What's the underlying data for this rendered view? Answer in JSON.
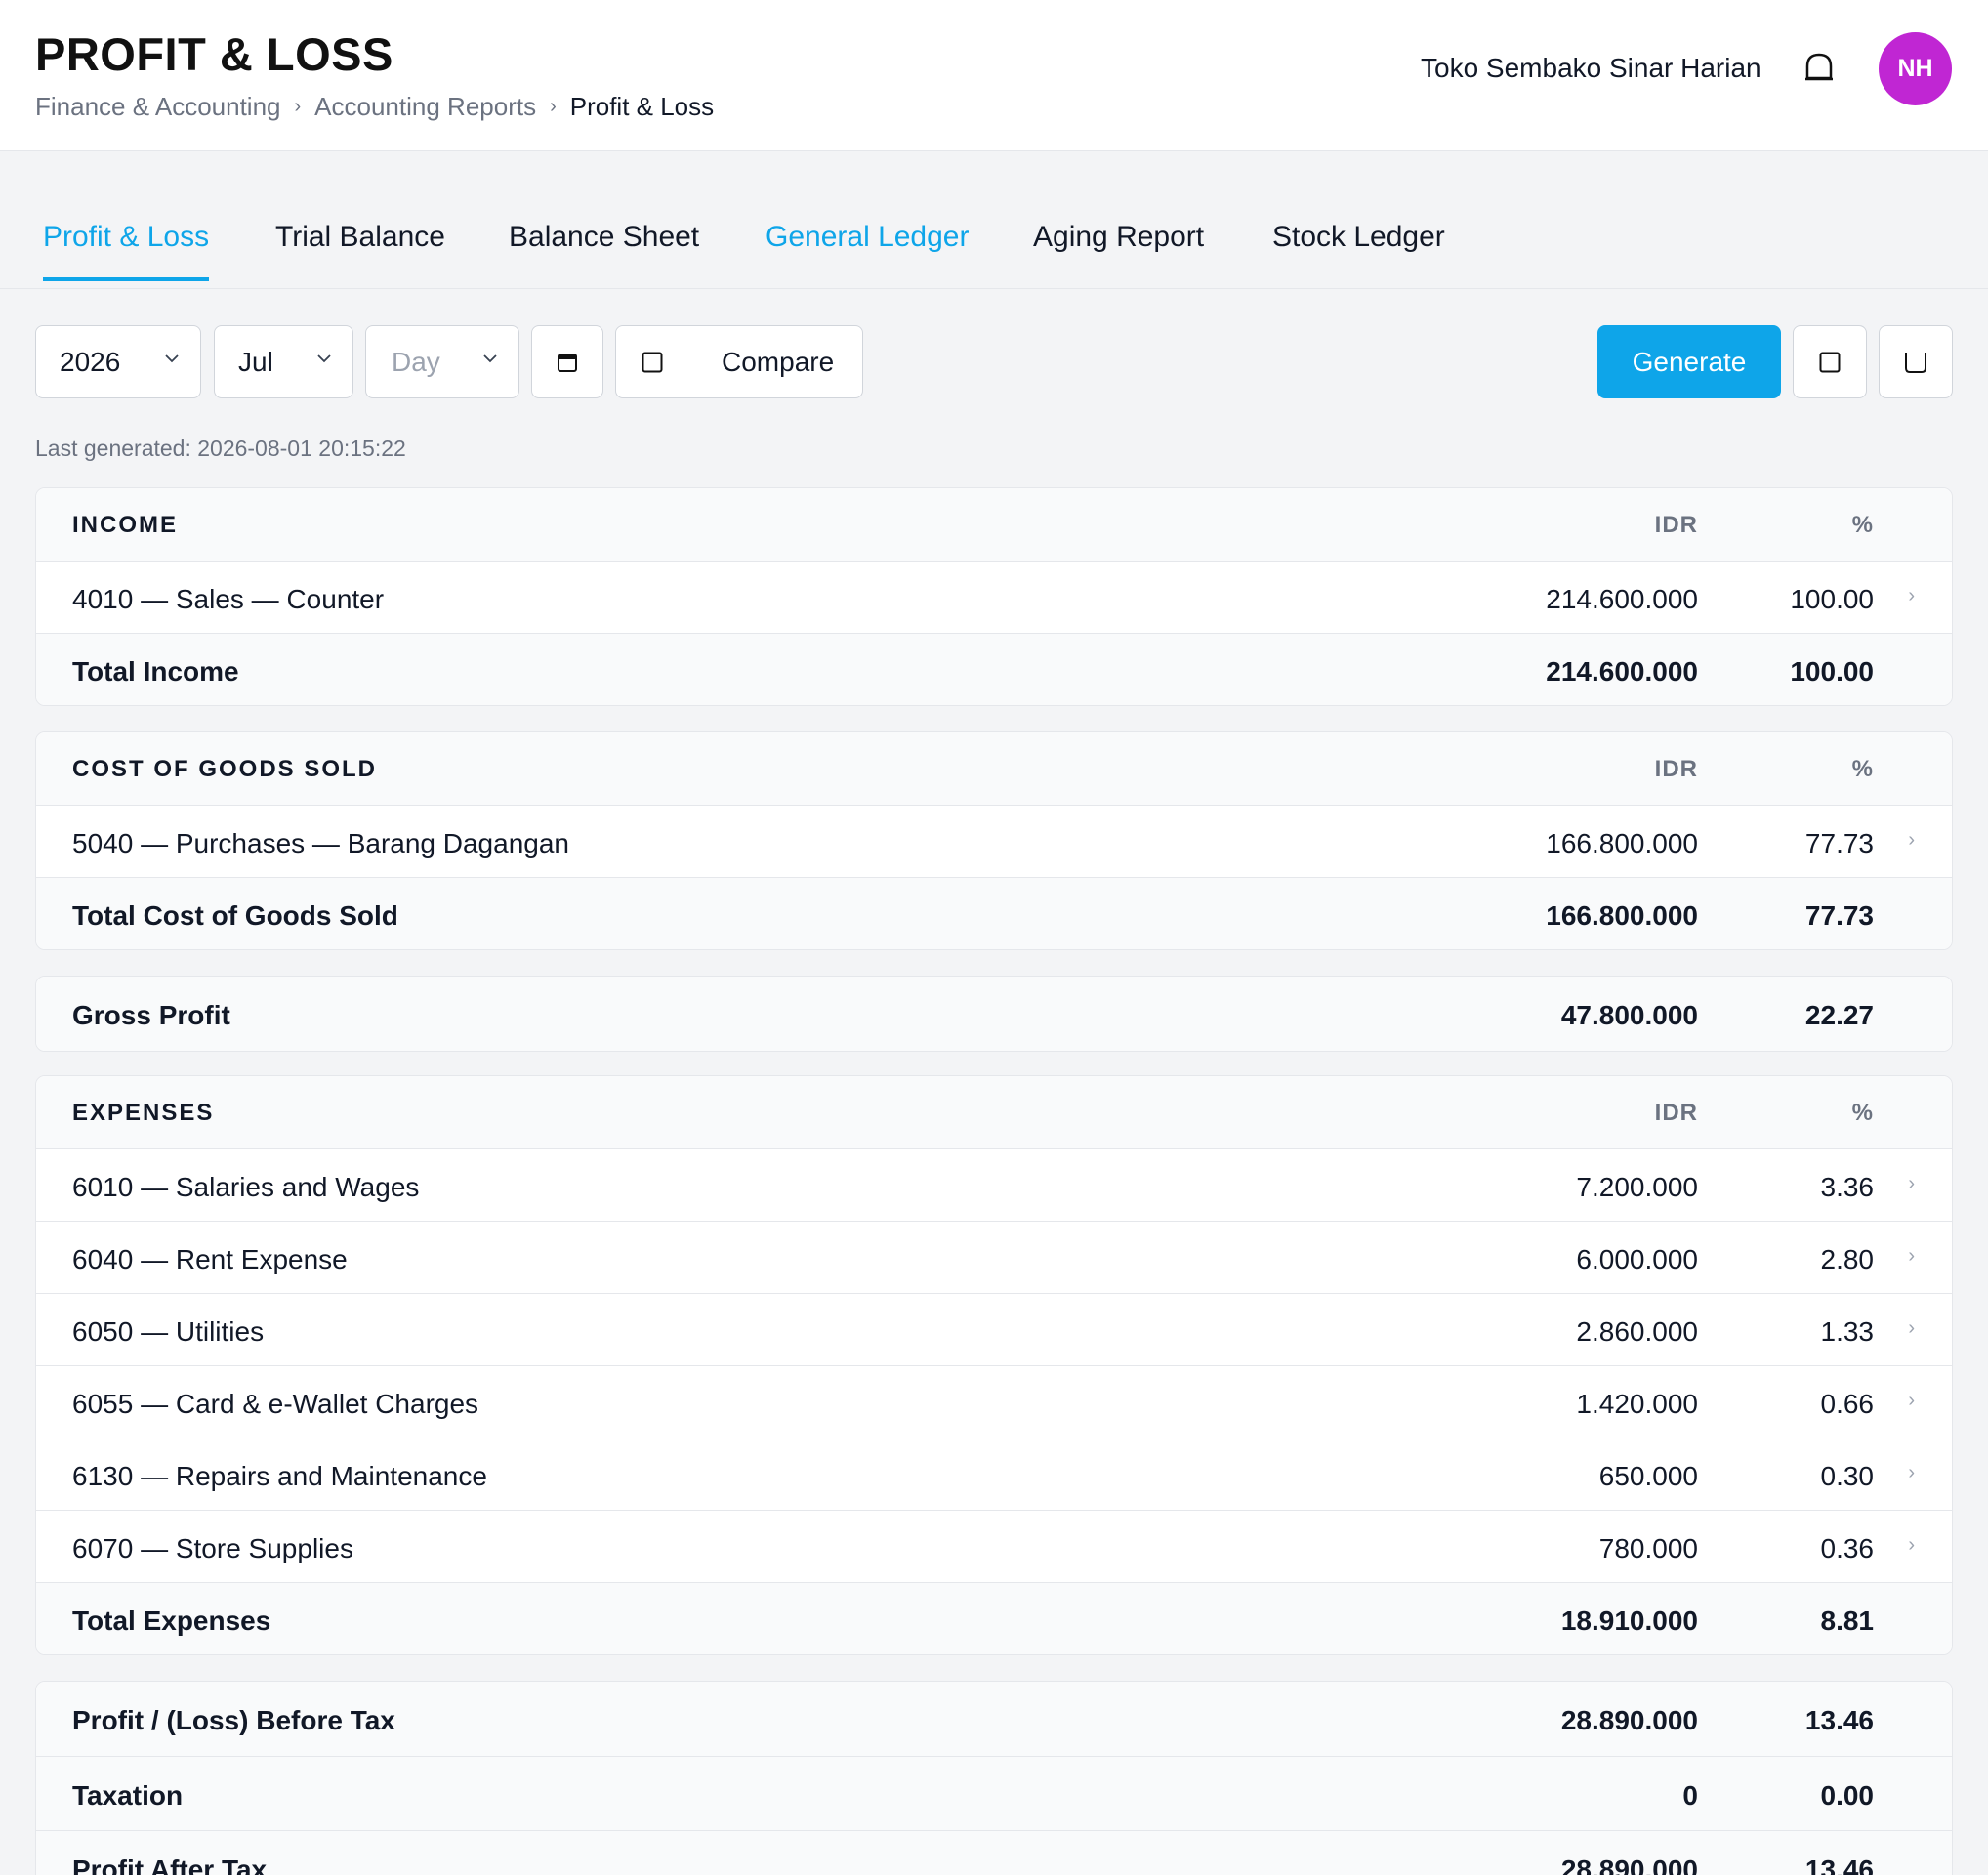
{
  "header": {
    "title": "PROFIT & LOSS",
    "breadcrumb": [
      "Finance & Accounting",
      "Accounting Reports",
      "Profit & Loss"
    ],
    "store_name": "Toko Sembako Sinar Harian",
    "avatar_initials": "NH"
  },
  "tabs": [
    {
      "label": "Profit & Loss",
      "state": "active"
    },
    {
      "label": "Trial Balance",
      "state": "normal"
    },
    {
      "label": "Balance Sheet",
      "state": "normal"
    },
    {
      "label": "General Ledger",
      "state": "link"
    },
    {
      "label": "Aging Report",
      "state": "normal"
    },
    {
      "label": "Stock Ledger",
      "state": "normal"
    }
  ],
  "toolbar": {
    "year": "2026",
    "month": "Jul",
    "day_placeholder": "Day",
    "compare_label": "Compare",
    "generate_label": "Generate"
  },
  "last_generated": "Last generated: 2026-08-01 20:15:22",
  "income": {
    "header": "INCOME",
    "col_amount": "IDR",
    "col_pct": "%",
    "rows": [
      {
        "label": "4010 — Sales — Counter",
        "amount": "214.600.000",
        "pct": "100.00"
      }
    ],
    "total": {
      "label": "Total Income",
      "amount": "214.600.000",
      "pct": "100.00"
    }
  },
  "cogs": {
    "header": "COST OF GOODS SOLD",
    "col_amount": "IDR",
    "col_pct": "%",
    "rows": [
      {
        "label": "5040 — Purchases — Barang Dagangan",
        "amount": "166.800.000",
        "pct": "77.73"
      }
    ],
    "total": {
      "label": "Total Cost of Goods Sold",
      "amount": "166.800.000",
      "pct": "77.73"
    }
  },
  "gross_profit": {
    "label": "Gross Profit",
    "amount": "47.800.000",
    "pct": "22.27"
  },
  "expenses": {
    "header": "EXPENSES",
    "col_amount": "IDR",
    "col_pct": "%",
    "rows": [
      {
        "label": "6010 — Salaries and Wages",
        "amount": "7.200.000",
        "pct": "3.36"
      },
      {
        "label": "6040 — Rent Expense",
        "amount": "6.000.000",
        "pct": "2.80"
      },
      {
        "label": "6050 — Utilities",
        "amount": "2.860.000",
        "pct": "1.33"
      },
      {
        "label": "6055 — Card & e-Wallet Charges",
        "amount": "1.420.000",
        "pct": "0.66"
      },
      {
        "label": "6130 — Repairs and Maintenance",
        "amount": "650.000",
        "pct": "0.30"
      },
      {
        "label": "6070 — Store Supplies",
        "amount": "780.000",
        "pct": "0.36"
      }
    ],
    "total": {
      "label": "Total Expenses",
      "amount": "18.910.000",
      "pct": "8.81"
    }
  },
  "summary": [
    {
      "label": "Profit / (Loss) Before Tax",
      "amount": "28.890.000",
      "pct": "13.46"
    },
    {
      "label": "Taxation",
      "amount": "0",
      "pct": "0.00"
    },
    {
      "label": "Profit After Tax",
      "amount": "28.890.000",
      "pct": "13.46"
    }
  ],
  "colors": {
    "accent": "#0ea5e9",
    "avatar": "#c026d3"
  }
}
